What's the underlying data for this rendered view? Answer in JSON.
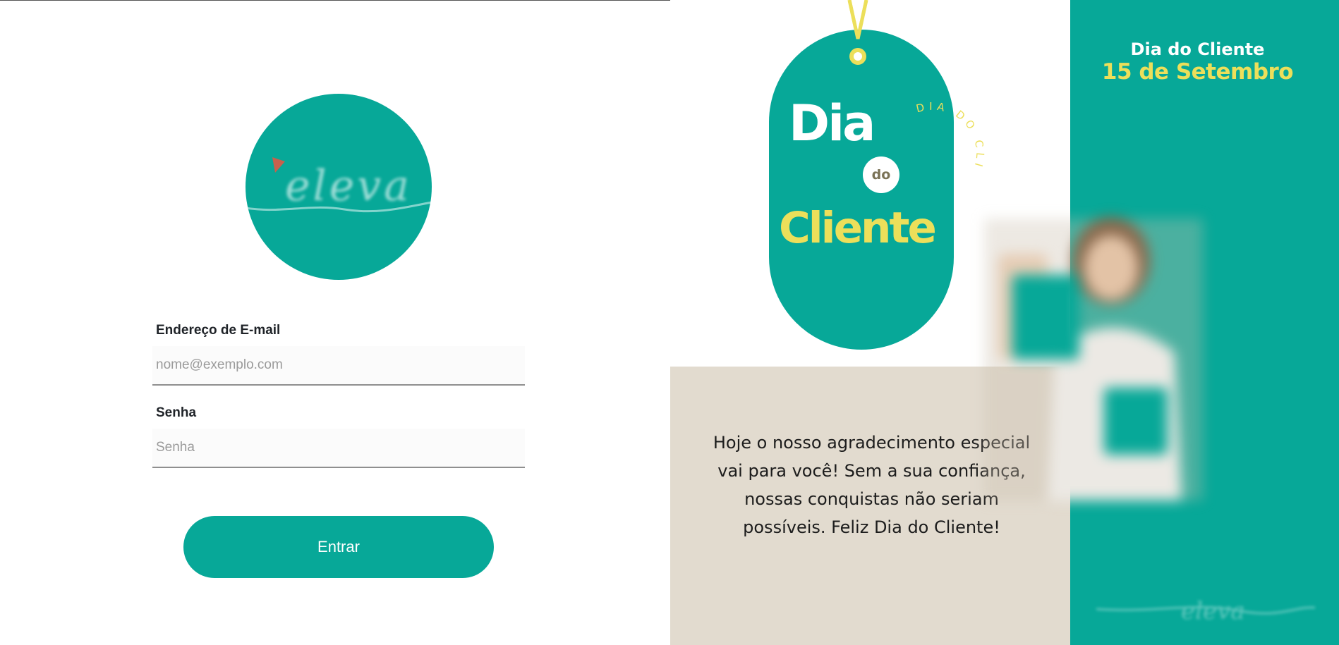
{
  "login": {
    "logo_text": "eleva",
    "email": {
      "label": "Endereço de E-mail",
      "placeholder": "nome@exemplo.com",
      "value": ""
    },
    "password": {
      "label": "Senha",
      "placeholder": "Senha",
      "value": ""
    },
    "submit_label": "Entrar"
  },
  "banner": {
    "tag_line1": "Dia",
    "tag_line2": "do",
    "tag_line3": "Cliente",
    "curved_text": "DIA DO CLIENTE",
    "date_title": "Dia do Cliente",
    "date_value": "15 de Setembro",
    "message_lines": [
      "Hoje o nosso agradecimento especial",
      "vai para você! Sem a sua confiança,",
      "nossas conquistas não seriam",
      "possíveis. Feliz Dia do Cliente!"
    ],
    "watermark_text": "eleva"
  },
  "colors": {
    "brand_teal": "#07a898",
    "accent_yellow": "#ecdf5a",
    "beige": "#e2dbcf",
    "olive_text": "#7a7256"
  }
}
